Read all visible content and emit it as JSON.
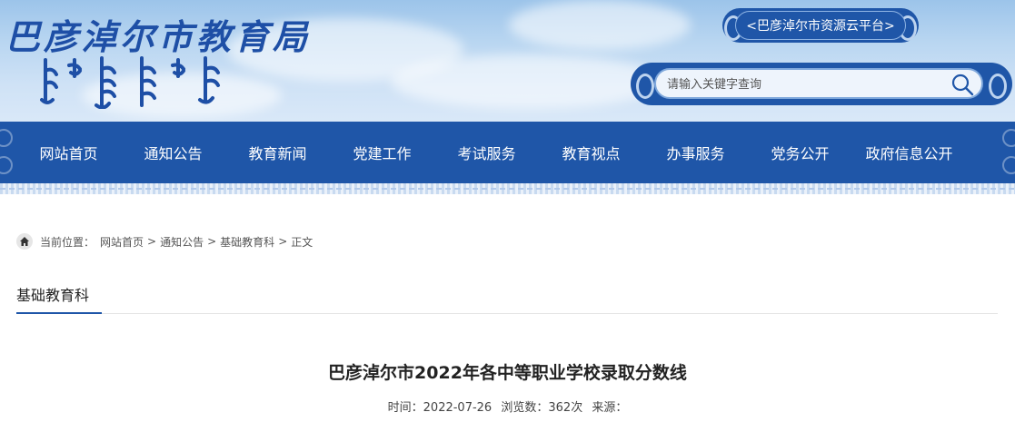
{
  "header": {
    "site_title": "巴彦淖尔市教育局",
    "resource_link": "<巴彦淖尔市资源云平台>",
    "search": {
      "placeholder": "请输入关键字查询",
      "value": ""
    }
  },
  "nav": {
    "items": [
      {
        "label": "网站首页"
      },
      {
        "label": "通知公告"
      },
      {
        "label": "教育新闻"
      },
      {
        "label": "党建工作"
      },
      {
        "label": "考试服务"
      },
      {
        "label": "教育视点"
      },
      {
        "label": "办事服务"
      },
      {
        "label": "党务公开"
      },
      {
        "label": "政府信息公开"
      }
    ]
  },
  "breadcrumb": {
    "prefix": "当前位置：",
    "items": [
      "网站首页",
      "通知公告",
      "基础教育科",
      "正文"
    ],
    "separator": ">"
  },
  "section": {
    "title": "基础教育科"
  },
  "article": {
    "title": "巴彦淖尔市2022年各中等职业学校录取分数线",
    "meta": {
      "time_label": "时间：",
      "time": "2022-07-26",
      "views_label": "浏览数：",
      "views": "362次",
      "source_label": "来源："
    }
  },
  "colors": {
    "brand_blue": "#1f56a8",
    "title_blue": "#1e4fa6"
  }
}
